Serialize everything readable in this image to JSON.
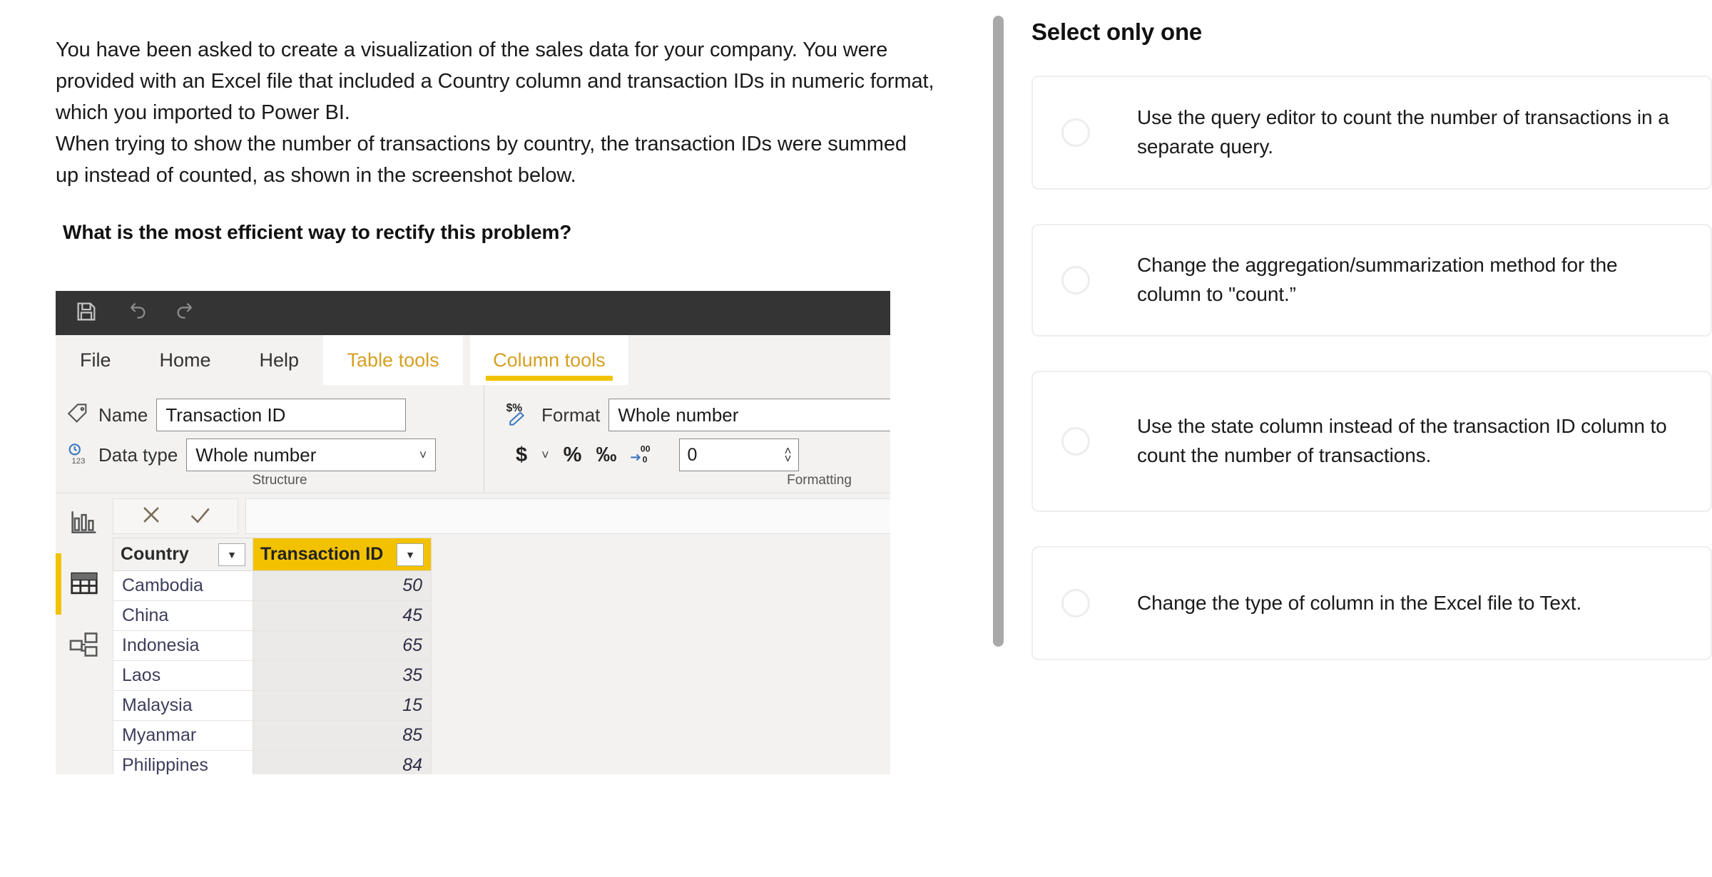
{
  "stem": {
    "paragraph_1": "You have been asked to create a visualization of the sales data for your company. You were provided with an Excel file that included a Country column and transaction IDs in numeric format, which you imported to Power BI.",
    "paragraph_2": "When trying to show the number of transactions by country, the transaction IDs were summed up instead of counted, as shown in the screenshot below.",
    "question": "What is the most efficient way to rectify this problem?"
  },
  "powerbi": {
    "titlebar": {
      "save_icon": "save-icon",
      "undo_icon": "undo-icon",
      "redo_icon": "redo-icon"
    },
    "tabs": [
      {
        "label": "File",
        "type": "plain",
        "active": false
      },
      {
        "label": "Home",
        "type": "plain",
        "active": false
      },
      {
        "label": "Help",
        "type": "plain",
        "active": false
      },
      {
        "label": "Table tools",
        "type": "context",
        "active": false
      },
      {
        "label": "Column tools",
        "type": "context",
        "active": true
      }
    ],
    "ribbon": {
      "structure": {
        "group_label": "Structure",
        "name_label": "Name",
        "name_value": "Transaction ID",
        "datatype_label": "Data type",
        "datatype_value": "Whole number"
      },
      "formatting": {
        "group_label": "Formatting",
        "format_label": "Format",
        "format_value": "Whole number",
        "currency_button": "$",
        "percent_button": "%",
        "thousands_button": "‰",
        "decimal_button": "decimal-places-icon",
        "decimal_value": "0"
      }
    },
    "rail": [
      {
        "icon": "report-view-icon",
        "active": false
      },
      {
        "icon": "data-view-icon",
        "active": true
      },
      {
        "icon": "model-view-icon",
        "active": false
      }
    ],
    "formula_bar": {
      "cancel_icon": "cancel-x-icon",
      "confirm_icon": "confirm-check-icon"
    },
    "table": {
      "columns": [
        {
          "name": "Country",
          "selected": false
        },
        {
          "name": "Transaction ID",
          "selected": true
        }
      ],
      "rows": [
        {
          "country": "Cambodia",
          "transaction_id": "50"
        },
        {
          "country": "China",
          "transaction_id": "45"
        },
        {
          "country": "Indonesia",
          "transaction_id": "65"
        },
        {
          "country": "Laos",
          "transaction_id": "35"
        },
        {
          "country": "Malaysia",
          "transaction_id": "15"
        },
        {
          "country": "Myanmar",
          "transaction_id": "85"
        },
        {
          "country": "Philippines",
          "transaction_id": "84"
        }
      ]
    }
  },
  "answers": {
    "heading": "Select only one",
    "options": [
      {
        "text": "Use the query editor to count the number of transactions in a separate query.",
        "selected": false
      },
      {
        "text": "Change the aggregation/summarization method for the column to \"count.”",
        "selected": false
      },
      {
        "text": "Use the state column instead of the transaction ID column to count the number of transactions.",
        "selected": false
      },
      {
        "text": "Change the type of column in the Excel file to Text.",
        "selected": false
      }
    ]
  },
  "colors": {
    "powerbi_yellow": "#f2c200",
    "tab_gold": "#d5a021",
    "titlebar": "#343434",
    "scrollbar": "#a9a9a9",
    "card_border": "#eeeeee"
  }
}
